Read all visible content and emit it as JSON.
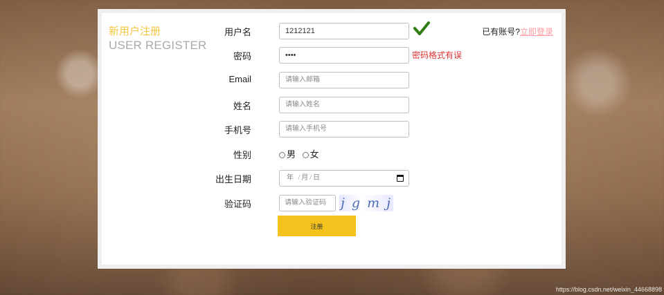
{
  "page": {
    "heading_zh": "新用户注册",
    "heading_en": "USER REGISTER"
  },
  "form": {
    "username_label": "用户名",
    "username_value": "1212121",
    "password_label": "密码",
    "password_value": "••••",
    "password_error": "密码格式有误",
    "email_label": "Email",
    "email_placeholder": "请输入邮箱",
    "name_label": "姓名",
    "name_placeholder": "请输入姓名",
    "phone_label": "手机号",
    "phone_placeholder": "请输入手机号",
    "gender_label": "性别",
    "gender_male": "男",
    "gender_female": "女",
    "birth_label": "出生日期",
    "birth_placeholder": "年 /月/日",
    "captcha_label": "验证码",
    "captcha_placeholder": "请输入验证码",
    "captcha_text": "j g m j",
    "submit_label": "注册"
  },
  "login": {
    "prefix": "已有账号?",
    "link": "立即登录"
  },
  "watermark": "https://blog.csdn.net/weixin_44668898",
  "colors": {
    "accent_yellow": "#f4c21d",
    "error_red": "#e03131",
    "link_pink": "#ff9aa2",
    "check_green": "#2f7d12"
  },
  "icons": {
    "checkmark": "checkmark-icon",
    "calendar": "calendar-icon"
  }
}
